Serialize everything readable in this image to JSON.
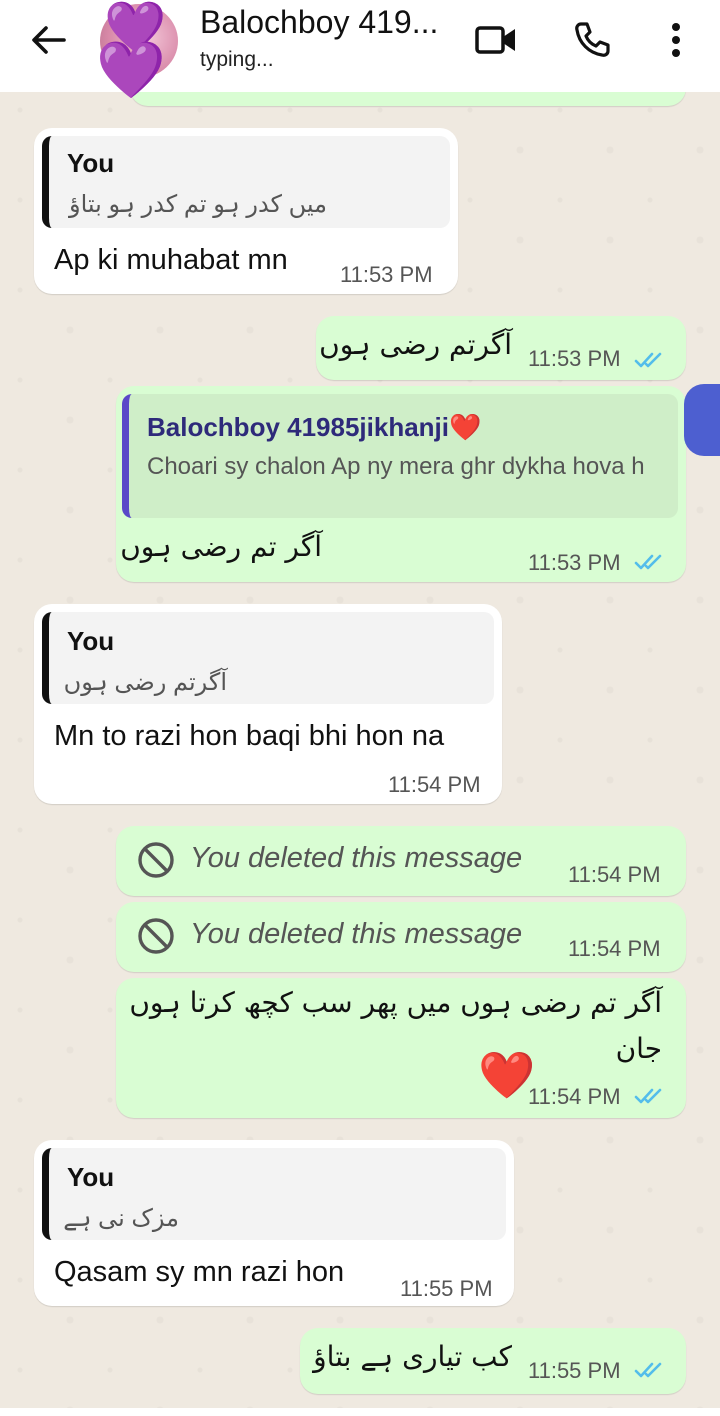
{
  "header": {
    "contact_name": "Balochboy 419...",
    "status": "typing..."
  },
  "messages": [
    {
      "id": 1,
      "direction": "incoming",
      "quote_author": "You",
      "quote_text": "میں کدر ہو تم کدر ہو بتاؤ",
      "text": "Ap ki muhabat mn",
      "time": "11:53 PM"
    },
    {
      "id": 2,
      "direction": "outgoing",
      "text": "آگرتم رضی ہوں",
      "time": "11:53 PM",
      "read": true
    },
    {
      "id": 3,
      "direction": "outgoing",
      "quote_author": "Balochboy 41985jikhanji❤️",
      "quote_text": "Choari sy chalon Ap ny mera ghr dykha hova h",
      "text": "آگر تم رضی ہوں",
      "time": "11:53 PM",
      "read": true
    },
    {
      "id": 4,
      "direction": "incoming",
      "quote_author": "You",
      "quote_text": "آگرتم رضی ہوں",
      "text": "Mn to razi hon baqi bhi hon na",
      "time": "11:54 PM"
    },
    {
      "id": 5,
      "direction": "outgoing",
      "deleted": true,
      "text": "You deleted this message",
      "time": "11:54 PM"
    },
    {
      "id": 6,
      "direction": "outgoing",
      "deleted": true,
      "text": "You deleted this message",
      "time": "11:54 PM"
    },
    {
      "id": 7,
      "direction": "outgoing",
      "text_line1": "آگر تم رضی ہوں میں پھر سب کچھ کرتا ہوں",
      "text_line2": "جان",
      "emoji": "❤️",
      "time": "11:54 PM",
      "read": true
    },
    {
      "id": 8,
      "direction": "incoming",
      "quote_author": "You",
      "quote_text": "مزک نی ہے",
      "text": "Qasam sy mn razi hon",
      "time": "11:55 PM"
    },
    {
      "id": 9,
      "direction": "outgoing",
      "text": "کب تیاری ہے بتاؤ",
      "time": "11:55 PM",
      "read": true
    }
  ],
  "colors": {
    "incoming_bubble": "#ffffff",
    "outgoing_bubble": "#d9fdd3",
    "read_ticks": "#53bdeb",
    "reply_accent": "#5a48c8"
  },
  "icons": [
    "back-arrow-icon",
    "video-call-icon",
    "phone-icon",
    "more-vert-icon",
    "blocked-icon",
    "double-check-icon"
  ]
}
